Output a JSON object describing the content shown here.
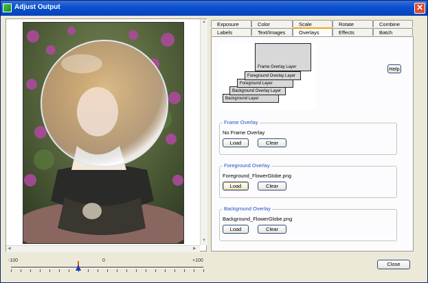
{
  "window": {
    "title": "Adjust Output",
    "close_glyph": "✕"
  },
  "slider": {
    "min_label": "-100",
    "mid_label": "0",
    "max_label": "+100",
    "value": -30
  },
  "tabs": {
    "row1": [
      "Exposure",
      "Color",
      "Scale",
      "Rotate",
      "Combine"
    ],
    "row2": [
      "Labels",
      "Text/Images",
      "Overlays",
      "Effects",
      "Batch"
    ],
    "active": "Overlays"
  },
  "help_label": "Help",
  "diagram_layers": [
    "Background Layer",
    "Background Overlay Layer",
    "Foreground Layer",
    "Foreground Overlay Layer",
    "Frame Overlay Layer"
  ],
  "groups": {
    "frame": {
      "title": "Frame Overlay",
      "value": "No Frame Overlay",
      "load": "Load",
      "clear": "Clear"
    },
    "foreground": {
      "title": "Foreground Overlay",
      "value": "Foreground_FlowerGlobe.png",
      "load": "Load",
      "clear": "Clear"
    },
    "background": {
      "title": "Background Overlay",
      "value": "Background_FlowerGlobe.png",
      "load": "Load",
      "clear": "Clear"
    }
  },
  "close_label": "Close",
  "colors": {
    "titlebar": "#0a52d2",
    "accent_tab": "#f2a016",
    "group_title": "#2050c0"
  }
}
